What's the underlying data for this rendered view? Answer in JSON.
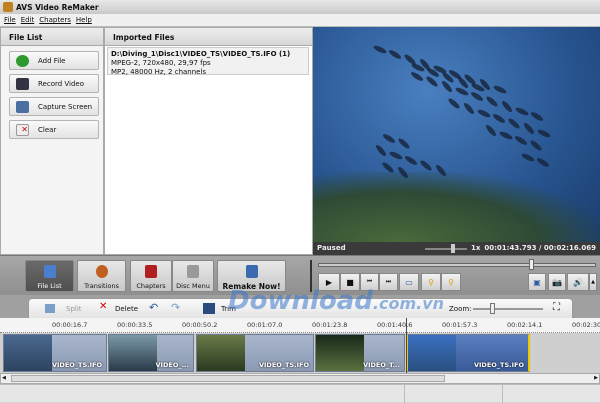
{
  "window": {
    "title": "AVS Video ReMaker"
  },
  "menu": [
    "File",
    "Edit",
    "Chapters",
    "Help"
  ],
  "file_list": {
    "header": "File List",
    "buttons": [
      {
        "label": "Add File",
        "icon": "plus-circle-icon"
      },
      {
        "label": "Record Video",
        "icon": "camcorder-icon"
      },
      {
        "label": "Capture Screen",
        "icon": "monitor-icon"
      },
      {
        "label": "Clear",
        "icon": "clear-doc-icon"
      }
    ]
  },
  "imported": {
    "header": "Imported Files",
    "items": [
      {
        "path": "D:\\Diving_1\\Disc1\\VIDEO_TS\\VIDEO_TS.IFO (1)",
        "video": "MPEG-2, 720x480, 29,97 fps",
        "audio": "MP2, 48000 Hz, 2 channels"
      }
    ]
  },
  "player": {
    "status": "Paused",
    "speed": "1x",
    "time": "00:01:43.793 / 00:02:16.069",
    "seek_fraction": 0.76
  },
  "toolbar": {
    "buttons": [
      "File List",
      "Transitions",
      "Chapters",
      "Disc Menu",
      "Remake Now!"
    ]
  },
  "timeline": {
    "split": "Split",
    "delete": "Delete",
    "trim": "Trim",
    "zoom": "Zoom:",
    "ticks": [
      "00:00:16.7",
      "00:00:33.5",
      "00:00:50.2",
      "00:01:07.0",
      "00:01:23.8",
      "00:01:40.6",
      "00:01:57.3",
      "00:02:14.1",
      "00:02:30"
    ],
    "clips": [
      "VIDEO_TS.IFO",
      "VIDEO_...",
      "VIDEO_TS.IFO",
      "VIDEO_T...",
      "VIDEO_TS.IFO"
    ]
  },
  "watermark": "Download.com.vn",
  "colors": {
    "accent": "#f0c800",
    "toolbar_bg": "#9a9a9a",
    "video_status_bg": "#3a3a3a"
  }
}
